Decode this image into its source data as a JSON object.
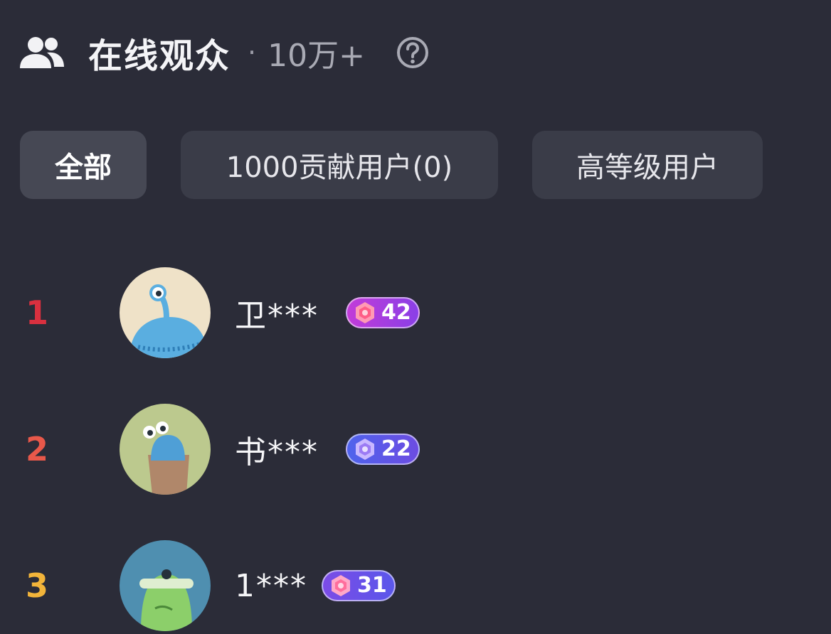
{
  "header": {
    "title": "在线观众",
    "separator": "·",
    "count": "10万+",
    "icon": "users-icon",
    "help_icon": "help-circle-icon"
  },
  "tabs": [
    {
      "label": "全部",
      "active": true
    },
    {
      "label": "1000贡献用户(0)",
      "active": false
    },
    {
      "label": "高等级用户",
      "active": false
    }
  ],
  "users": [
    {
      "rank": "1",
      "name": "卫***",
      "level": "42",
      "rank_color": "#d9303f",
      "badge_color": "#b03ce0"
    },
    {
      "rank": "2",
      "name": "书***",
      "level": "22",
      "rank_color": "#e8584a",
      "badge_color": "#5b55e6"
    },
    {
      "rank": "3",
      "name": "1***",
      "level": "31",
      "rank_color": "#f2b43a",
      "badge_color": "#6f4de2"
    }
  ],
  "colors": {
    "background": "#2b2c38",
    "tab_bg": "#3a3c48",
    "tab_active_bg": "#464854"
  }
}
